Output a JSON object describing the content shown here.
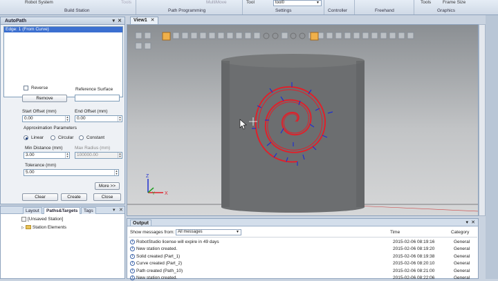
{
  "ribbon": {
    "station_title": "Robot System",
    "tools_small": "Tools",
    "multimove": "MultiMove",
    "tool_label": "Tool",
    "tool_value": "tool0",
    "tools_right": "Tools",
    "frame_size": "Frame Size",
    "groups": [
      "Build Station",
      "Path Programming",
      "Settings",
      "Controller",
      "Freehand",
      "Graphics"
    ]
  },
  "autopath": {
    "title": "AutoPath",
    "edge_item": "Edge: 1 (From Curve)",
    "reverse_label": "Reverse",
    "reference_surface_label": "Reference Surface",
    "remove_label": "Remove",
    "start_offset_label": "Start Offset (mm)",
    "start_offset_value": "0.00",
    "end_offset_label": "End Offset (mm)",
    "end_offset_value": "0.00",
    "approx_label": "Approximation Parameters",
    "linear_label": "Linear",
    "circular_label": "Circular",
    "constant_label": "Constant",
    "min_distance_label": "Min Distance (mm)",
    "min_distance_value": "3.00",
    "max_radius_label": "Max Radius (mm)",
    "max_radius_value": "100000.00",
    "tolerance_label": "Tolerance (mm)",
    "tolerance_value": "5.00",
    "more_label": "More >>",
    "clear_label": "Clear",
    "create_label": "Create",
    "close_label": "Close"
  },
  "tabs": {
    "layout": "Layout",
    "paths_targets": "Paths&Targets",
    "tags": "Tags"
  },
  "tree": {
    "station": "[Unsaved Station]",
    "station_elements": "Station Elements"
  },
  "view": {
    "tab_label": "View1"
  },
  "output": {
    "title": "Output",
    "show_from_label": "Show messages from:",
    "filter_value": "All messages",
    "col_time": "Time",
    "col_category": "Category",
    "messages": [
      {
        "text": "RobotStudio license will expire in 49 days",
        "time": "2015-02-06 08:19:16",
        "category": "General"
      },
      {
        "text": "New station created.",
        "time": "2015-02-06 08:19:20",
        "category": "General"
      },
      {
        "text": "Solid created (Part_1)",
        "time": "2015-02-06 08:19:38",
        "category": "General"
      },
      {
        "text": "Curve created (Part_2)",
        "time": "2015-02-06 08:20:10",
        "category": "General"
      },
      {
        "text": "Path created (Path_10)",
        "time": "2015-02-06 08:21:00",
        "category": "General"
      },
      {
        "text": "New station created.",
        "time": "2015-02-06 08:22:06",
        "category": "General"
      }
    ]
  },
  "colors": {
    "path_red": "#e0202a",
    "target_blue": "#1f2fd0",
    "cylinder": "#6c6e70"
  }
}
